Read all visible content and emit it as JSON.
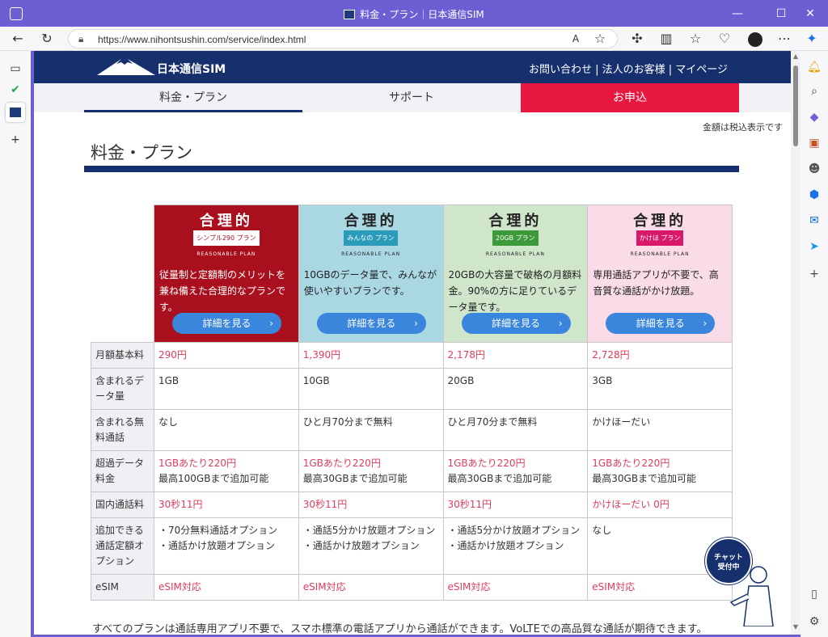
{
  "browser": {
    "window_title": "料金・プラン｜日本通信SIM",
    "url": "https://www.nihontsushin.com/service/index.html",
    "minimize": "—",
    "maximize": "☐",
    "close": "✕"
  },
  "site": {
    "logo_text": "日本通信SIM",
    "header_links": "お問い合わせ | 法人のお客様 | マイページ",
    "nav": [
      "料金・プラン",
      "サポート",
      "お申込"
    ],
    "tax_note": "金額は税込表示です",
    "page_title": "料金・プラン"
  },
  "plans": [
    {
      "logo": "合理的",
      "badge": "シンプル290",
      "badge_suffix": "プラン",
      "sub": "REASONABLE PLAN",
      "desc": "従量制と定額制のメリットを兼ね備えた合理的なプランです。",
      "button": "詳細を見る",
      "bg": "#a90f1c",
      "badge_bg": "#ffffff",
      "badge_color": "#a90f1c",
      "text_color": "#ffffff"
    },
    {
      "logo": "合理的",
      "badge": "みんなの",
      "badge_suffix": "プラン",
      "sub": "REASONABLE PLAN",
      "desc": "10GBのデータ量で、みんなが使いやすいプランです。",
      "button": "詳細を見る",
      "bg": "#a9d8e3",
      "badge_bg": "#2a9bb8",
      "badge_color": "#ffffff",
      "text_color": "#222222"
    },
    {
      "logo": "合理的",
      "badge": "20GB",
      "badge_suffix": "プラン",
      "sub": "REASONABLE PLAN",
      "desc": "20GBの大容量で破格の月額料金。90%の方に足りているデータ量です。",
      "button": "詳細を見る",
      "bg": "#cfe6cb",
      "badge_bg": "#3c9a3a",
      "badge_color": "#ffffff",
      "text_color": "#222222"
    },
    {
      "logo": "合理的",
      "badge": "かけほ",
      "badge_suffix": "プラン",
      "sub": "REASONABLE PLAN",
      "desc": "専用通話アプリが不要で、高音質な通話がかけ放題。",
      "button": "詳細を見る",
      "bg": "#fadbe8",
      "badge_bg": "#d8196a",
      "badge_color": "#ffffff",
      "text_color": "#222222"
    }
  ],
  "rows": [
    {
      "label": "月額基本料",
      "cells": [
        [
          "290円"
        ],
        [
          "1,390円"
        ],
        [
          "2,178円"
        ],
        [
          "2,728円"
        ]
      ],
      "red": [
        [
          true
        ],
        [
          true
        ],
        [
          true
        ],
        [
          true
        ]
      ]
    },
    {
      "label": "含まれるデータ量",
      "cells": [
        [
          "1GB"
        ],
        [
          "10GB"
        ],
        [
          "20GB"
        ],
        [
          "3GB"
        ]
      ],
      "red": [
        [
          false
        ],
        [
          false
        ],
        [
          false
        ],
        [
          false
        ]
      ]
    },
    {
      "label": "含まれる無料通話",
      "cells": [
        [
          "なし"
        ],
        [
          "ひと月70分まで無料"
        ],
        [
          "ひと月70分まで無料"
        ],
        [
          "かけほーだい"
        ]
      ],
      "red": [
        [
          false
        ],
        [
          false
        ],
        [
          false
        ],
        [
          false
        ]
      ]
    },
    {
      "label": "超過データ料金",
      "cells": [
        [
          "1GBあたり220円",
          "最高100GBまで追加可能"
        ],
        [
          "1GBあたり220円",
          "最高30GBまで追加可能"
        ],
        [
          "1GBあたり220円",
          "最高30GBまで追加可能"
        ],
        [
          "1GBあたり220円",
          "最高30GBまで追加可能"
        ]
      ],
      "red": [
        [
          true,
          false
        ],
        [
          true,
          false
        ],
        [
          true,
          false
        ],
        [
          true,
          false
        ]
      ]
    },
    {
      "label": "国内通話料",
      "cells": [
        [
          "30秒11円"
        ],
        [
          "30秒11円"
        ],
        [
          "30秒11円"
        ],
        [
          "かけほーだい 0円"
        ]
      ],
      "red": [
        [
          true
        ],
        [
          true
        ],
        [
          true
        ],
        [
          true
        ]
      ]
    },
    {
      "label": "追加できる通話定額オプション",
      "cells": [
        [
          "・70分無料通話オプション",
          "・通話かけ放題オプション"
        ],
        [
          "・通話5分かけ放題オプション",
          "・通話かけ放題オプション"
        ],
        [
          "・通話5分かけ放題オプション",
          "・通話かけ放題オプション"
        ],
        [
          "なし"
        ]
      ],
      "red": [
        [
          false,
          false
        ],
        [
          false,
          false
        ],
        [
          false,
          false
        ],
        [
          false
        ]
      ]
    },
    {
      "label": "eSIM",
      "cells": [
        [
          "eSIM対応"
        ],
        [
          "eSIM対応"
        ],
        [
          "eSIM対応"
        ],
        [
          "eSIM対応"
        ]
      ],
      "red": [
        [
          true
        ],
        [
          true
        ],
        [
          true
        ],
        [
          true
        ]
      ]
    }
  ],
  "footer_note": "すべてのプランは通話専用アプリ不要で、スマホ標準の電話アプリから通話ができます。VoLTEでの高品質な通話が期待できます。",
  "chat": {
    "line1": "チャット",
    "line2": "受付中"
  }
}
